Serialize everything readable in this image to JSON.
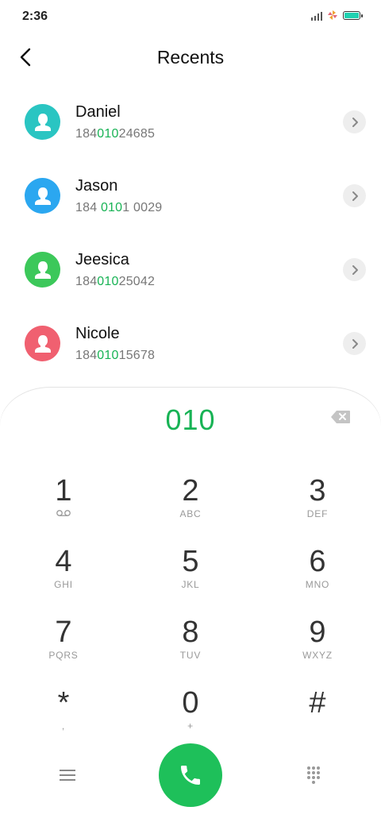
{
  "status_bar": {
    "time": "2:36",
    "battery_color": "#1fd1b0"
  },
  "header": {
    "title": "Recents",
    "back_icon": "back-arrow-icon"
  },
  "contacts": [
    {
      "name": "Daniel",
      "number_parts": [
        "184",
        "010",
        "24685"
      ],
      "avatar_color": "#2ac5c2"
    },
    {
      "name": "Jason",
      "number_parts": [
        "184 ",
        "010",
        "1 0029"
      ],
      "avatar_color": "#2ba7f0"
    },
    {
      "name": "Jeesica",
      "number_parts": [
        "184",
        "010",
        "25042"
      ],
      "avatar_color": "#3cc85a"
    },
    {
      "name": "Nicole",
      "number_parts": [
        "184",
        "010",
        "15678"
      ],
      "avatar_color": "#f06070"
    }
  ],
  "dialer": {
    "input_value": "010",
    "accent_color": "#18b355",
    "keys": [
      {
        "digit": "1",
        "letters": ""
      },
      {
        "digit": "2",
        "letters": "ABC"
      },
      {
        "digit": "3",
        "letters": "DEF"
      },
      {
        "digit": "4",
        "letters": "GHI"
      },
      {
        "digit": "5",
        "letters": "JKL"
      },
      {
        "digit": "6",
        "letters": "MNO"
      },
      {
        "digit": "7",
        "letters": "PQRS"
      },
      {
        "digit": "8",
        "letters": "TUV"
      },
      {
        "digit": "9",
        "letters": "WXYZ"
      },
      {
        "digit": "*",
        "letters": ","
      },
      {
        "digit": "0",
        "letters": "+"
      },
      {
        "digit": "#",
        "letters": ""
      }
    ],
    "call_button_color": "#1ec05a"
  }
}
